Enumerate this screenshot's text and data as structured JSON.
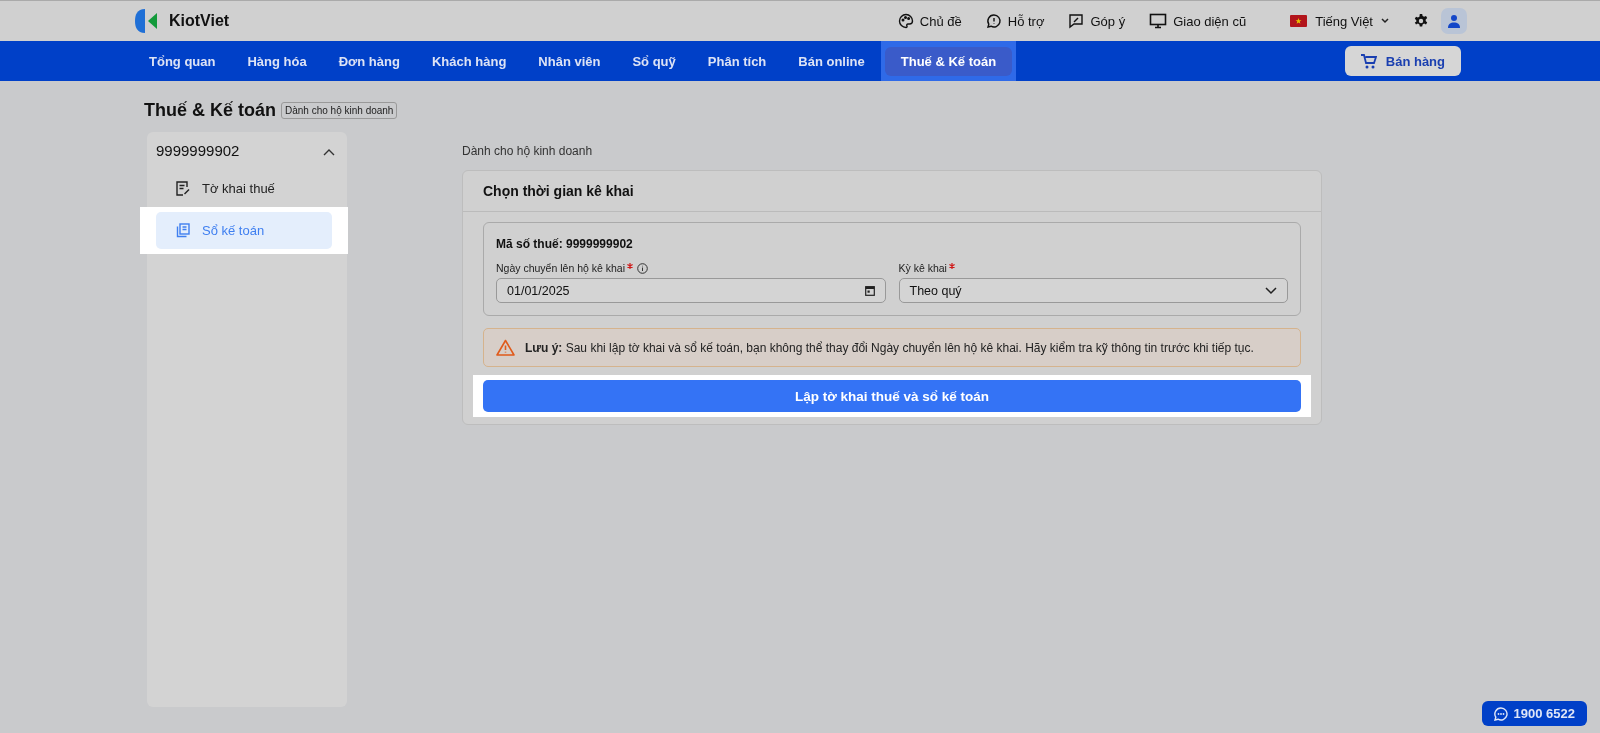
{
  "header": {
    "logo": "KiotViet",
    "links": [
      {
        "kind": "theme",
        "label": "Chủ đề"
      },
      {
        "kind": "support",
        "label": "Hỗ trợ"
      },
      {
        "kind": "feedback",
        "label": "Góp ý"
      },
      {
        "kind": "classic",
        "label": "Giao diện cũ"
      }
    ],
    "language": "Tiếng Việt"
  },
  "nav": {
    "tabs": [
      {
        "label": "Tổng quan",
        "selected": false
      },
      {
        "label": "Hàng hóa",
        "selected": false
      },
      {
        "label": "Đơn hàng",
        "selected": false
      },
      {
        "label": "Khách hàng",
        "selected": false
      },
      {
        "label": "Nhân viên",
        "selected": false
      },
      {
        "label": "Sổ quỹ",
        "selected": false
      },
      {
        "label": "Phân tích",
        "selected": false
      },
      {
        "label": "Bán online",
        "selected": false
      },
      {
        "label": "Thuế & Kế toán",
        "selected": true
      }
    ],
    "sell_button": "Bán hàng"
  },
  "page": {
    "title": "Thuế & Kế toán",
    "badge": "Dành cho hộ kinh doanh"
  },
  "sidebar": {
    "account": "9999999902",
    "expanded": true,
    "items": [
      {
        "kind": "declaration",
        "label": "Tờ khai thuế",
        "selected": false
      },
      {
        "kind": "ledger",
        "label": "Sổ kế toán",
        "selected": true
      }
    ]
  },
  "main": {
    "caption": "Dành cho hộ kinh doanh",
    "card_title": "Chọn thời gian kê khai",
    "tax_code": "Mã số thuế: 9999999902",
    "fields": [
      {
        "kind": "date",
        "label": "Ngày chuyển lên hộ kê khai",
        "required": true,
        "info": true,
        "value": "01/01/2025"
      },
      {
        "kind": "select",
        "label": "Kỳ kê khai",
        "required": true,
        "info": false,
        "value": "Theo quý"
      }
    ],
    "note": "**Lưu ý:** Sau khi lập tờ khai và sổ kế toán, bạn không thể thay đổi Ngày chuyển lên hộ kê khai. Hãy kiểm tra kỹ thông tin trước khi tiếp tục.",
    "submit": "Lập tờ khai thuế và sổ kế toán"
  },
  "hotline": "1900 6522"
}
